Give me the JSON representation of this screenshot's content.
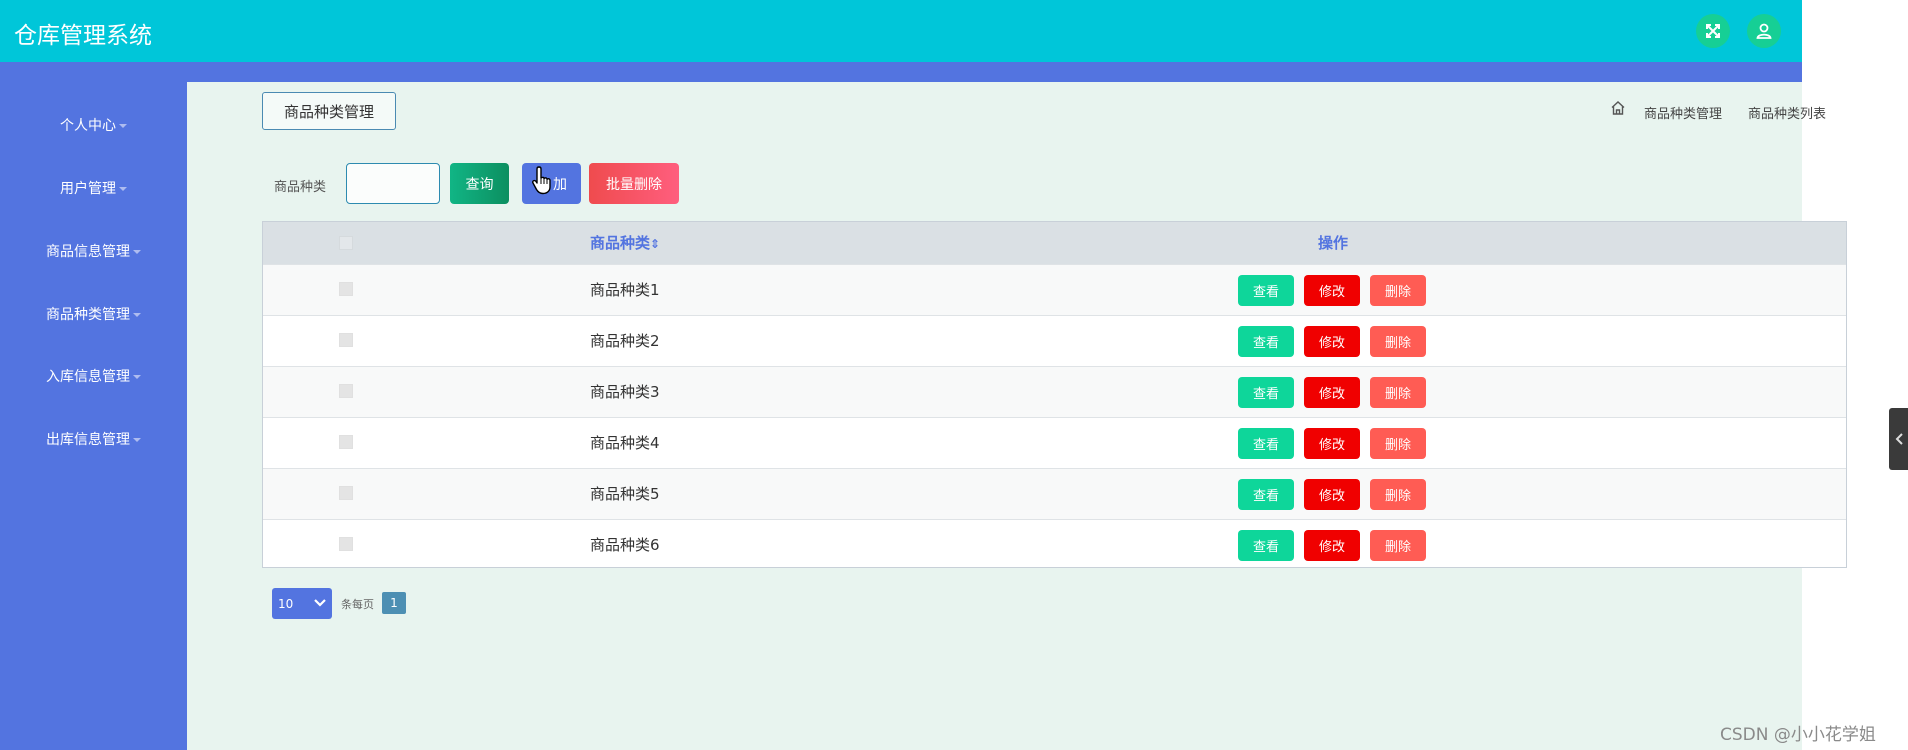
{
  "header": {
    "app_title": "仓库管理系统",
    "fullscreen_icon": "fullscreen-icon",
    "user_icon": "user-icon",
    "accent": "#00c6d9"
  },
  "sidebar": {
    "items": [
      {
        "label": "个人中心"
      },
      {
        "label": "用户管理"
      },
      {
        "label": "商品信息管理"
      },
      {
        "label": "商品种类管理"
      },
      {
        "label": "入库信息管理"
      },
      {
        "label": "出库信息管理"
      }
    ],
    "color": "#5374e0"
  },
  "page": {
    "title": "商品种类管理",
    "breadcrumb": [
      "商品种类管理",
      "商品种类列表"
    ]
  },
  "search": {
    "label": "商品种类",
    "value": "",
    "query_label": "查询",
    "add_label": "加",
    "batch_delete_label": "批量删除"
  },
  "table": {
    "columns": [
      "商品种类",
      "操作"
    ],
    "sort_indicator": "⇕",
    "rows": [
      {
        "name": "商品种类1"
      },
      {
        "name": "商品种类2"
      },
      {
        "name": "商品种类3"
      },
      {
        "name": "商品种类4"
      },
      {
        "name": "商品种类5"
      },
      {
        "name": "商品种类6"
      }
    ],
    "actions": {
      "view": "查看",
      "edit": "修改",
      "delete": "删除"
    }
  },
  "pagination": {
    "page_size": "10",
    "per_page_label": "条每页",
    "current_page": "1"
  },
  "watermark": "CSDN @小小花学姐"
}
